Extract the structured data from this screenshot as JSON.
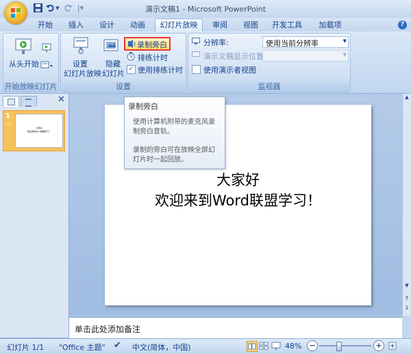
{
  "window": {
    "title": "演示文稿1 - Microsoft PowerPoint"
  },
  "quick_access": {
    "save_icon": "save-icon",
    "undo_icon": "undo-icon",
    "redo_icon": "redo-icon"
  },
  "tabs": [
    {
      "label": "开始"
    },
    {
      "label": "插入"
    },
    {
      "label": "设计"
    },
    {
      "label": "动画"
    },
    {
      "label": "幻灯片放映",
      "active": true
    },
    {
      "label": "审阅"
    },
    {
      "label": "视图"
    },
    {
      "label": "开发工具"
    },
    {
      "label": "加载项"
    }
  ],
  "ribbon": {
    "start_group": {
      "from_start": "从头开始",
      "label": "开始放映幻灯片"
    },
    "setup_group": {
      "setup_show": "设置\n幻灯片放映",
      "setup_line1": "设置",
      "setup_line2": "幻灯片放映",
      "hide_line1": "隐藏",
      "hide_line2": "幻灯片",
      "record_narration": "录制旁白",
      "rehearse_timings": "排练计时",
      "use_timings": "使用排练计时",
      "label": "设置"
    },
    "monitors_group": {
      "resolution_label": "分辨率:",
      "resolution_value": "使用当前分辨率",
      "show_on_label": "演示文稿显示位置:",
      "show_on_value": "",
      "presenter_view": "使用演示者视图",
      "label": "监视器"
    }
  },
  "tooltip": {
    "title": "录制旁白",
    "line1": "使用计算机附带的麦克风录",
    "line2": "制旁白音轨。",
    "line3": "录制的旁白可在放映全屏幻",
    "line4": "灯片时一起回放。"
  },
  "slide_pane": {
    "slide_number": "1",
    "star": "☆"
  },
  "slide": {
    "line1": "大家好",
    "line2": "欢迎来到Word联盟学习！"
  },
  "notes": {
    "placeholder": "单击此处添加备注"
  },
  "status": {
    "slide_count": "幻灯片 1/1",
    "theme": "\"Office 主题\"",
    "language": "中文(简体，中国)",
    "zoom": "48%"
  },
  "colors": {
    "accent": "#15428b",
    "highlight": "#e8343a",
    "selection": "#f8c15a"
  }
}
